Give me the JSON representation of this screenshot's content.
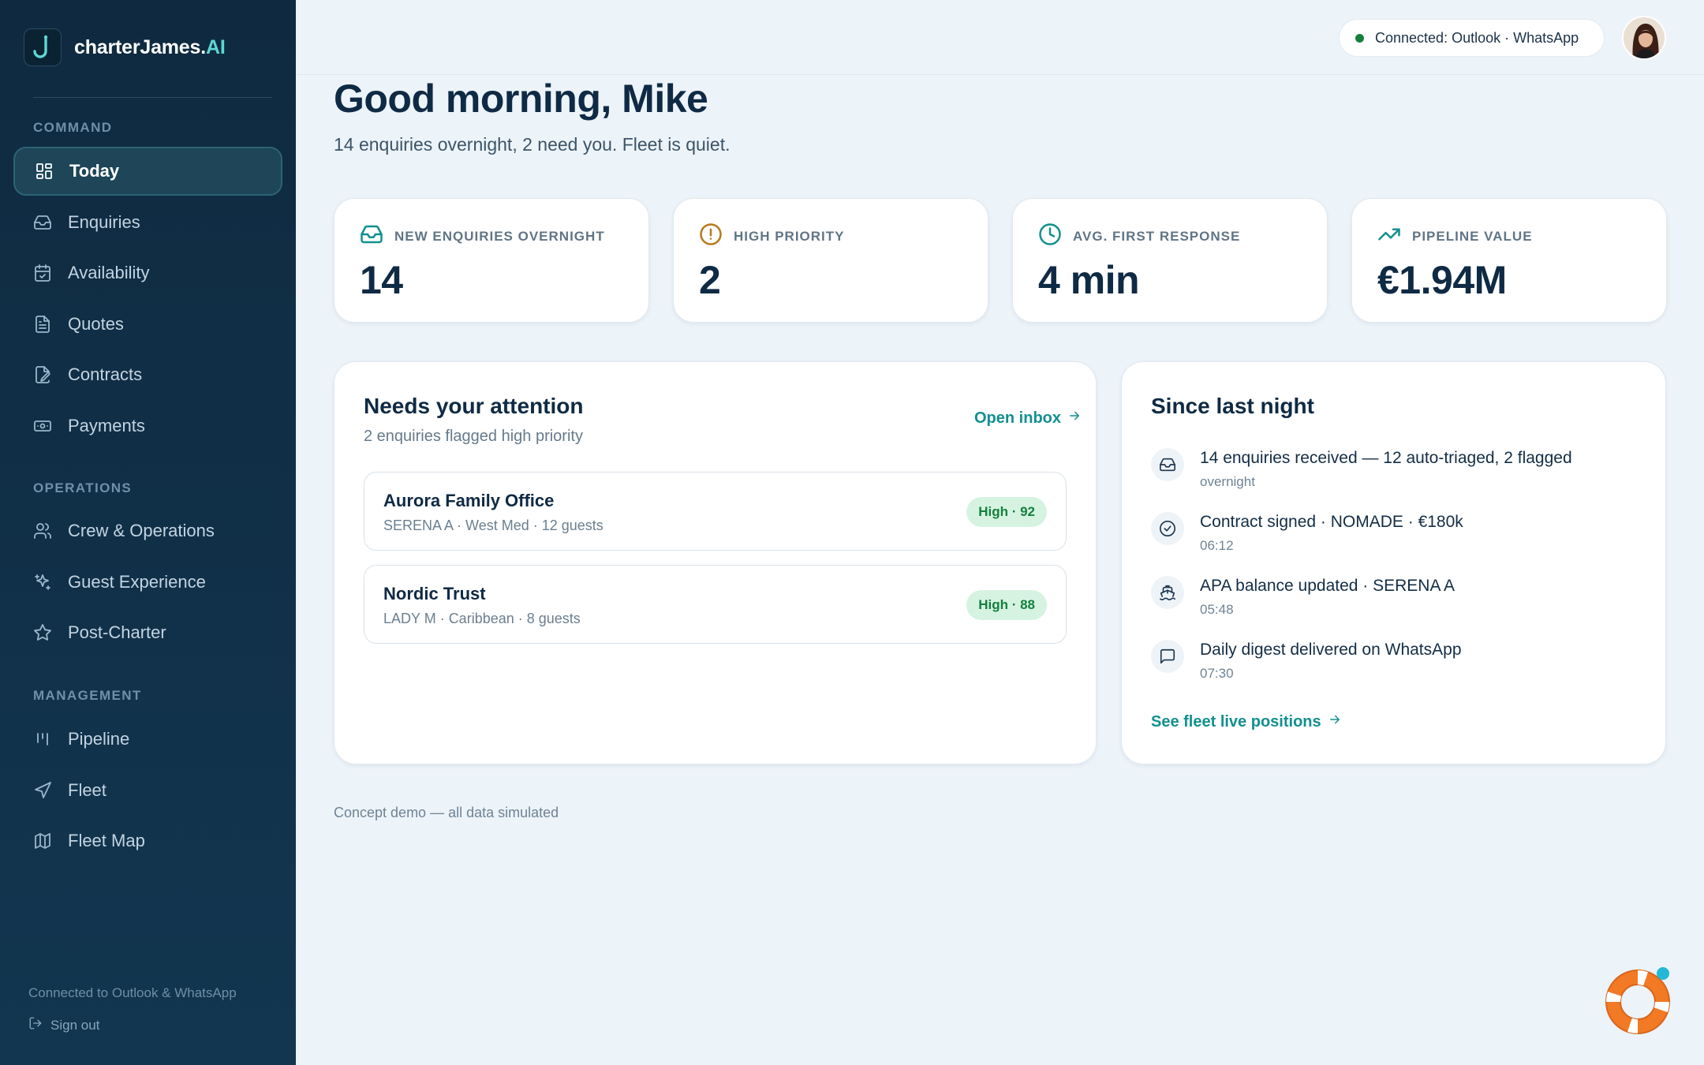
{
  "brand": {
    "name": "charterJames.",
    "suffix": "AI"
  },
  "sidebar": {
    "sections": [
      {
        "label": "COMMAND",
        "items": [
          {
            "label": "Today",
            "icon": "dashboard-icon",
            "active": true
          },
          {
            "label": "Enquiries",
            "icon": "inbox-icon"
          },
          {
            "label": "Availability",
            "icon": "calendar-check-icon"
          },
          {
            "label": "Quotes",
            "icon": "document-icon"
          },
          {
            "label": "Contracts",
            "icon": "file-signature-icon"
          },
          {
            "label": "Payments",
            "icon": "banknote-icon"
          }
        ]
      },
      {
        "label": "OPERATIONS",
        "items": [
          {
            "label": "Crew & Operations",
            "icon": "users-icon"
          },
          {
            "label": "Guest Experience",
            "icon": "sparkles-icon"
          },
          {
            "label": "Post-Charter",
            "icon": "star-icon"
          }
        ]
      },
      {
        "label": "MANAGEMENT",
        "items": [
          {
            "label": "Pipeline",
            "icon": "kanban-icon"
          },
          {
            "label": "Fleet",
            "icon": "navigation-icon"
          },
          {
            "label": "Fleet Map",
            "icon": "map-icon"
          }
        ]
      }
    ],
    "footer_text": "Connected to Outlook & WhatsApp",
    "signout_label": "Sign out"
  },
  "topbar": {
    "connection_status": "Connected: Outlook · WhatsApp",
    "status_color": "#15803d"
  },
  "greeting": {
    "title": "Good morning, Mike",
    "subtitle": "14 enquiries overnight, 2 need you. Fleet is quiet."
  },
  "stats": [
    {
      "label": "NEW ENQUIRIES OVERNIGHT",
      "value": "14",
      "icon": "inbox-icon",
      "color": "#12908f"
    },
    {
      "label": "HIGH PRIORITY",
      "value": "2",
      "icon": "alert-circle-icon",
      "color": "#b7791f"
    },
    {
      "label": "AVG. FIRST RESPONSE",
      "value": "4 min",
      "icon": "clock-icon",
      "color": "#12908f"
    },
    {
      "label": "PIPELINE VALUE",
      "value": "€1.94M",
      "icon": "trending-up-icon",
      "color": "#12908f"
    }
  ],
  "attention": {
    "title": "Needs your attention",
    "subtitle": "2 enquiries flagged high priority",
    "open_inbox_label": "Open inbox",
    "items": [
      {
        "name": "Aurora Family Office",
        "meta": "SERENA A · West Med · 12 guests",
        "badge": "High · 92"
      },
      {
        "name": "Nordic Trust",
        "meta": "LADY M · Caribbean · 8 guests",
        "badge": "High · 88"
      }
    ]
  },
  "activity": {
    "title": "Since last night",
    "items": [
      {
        "text": "14 enquiries received — 12 auto-triaged, 2 flagged",
        "time": "overnight",
        "icon": "inbox-icon"
      },
      {
        "text": "Contract signed · NOMADE · €180k",
        "time": "06:12",
        "icon": "check-circle-icon"
      },
      {
        "text": "APA balance updated · SERENA A",
        "time": "05:48",
        "icon": "ship-icon"
      },
      {
        "text": "Daily digest delivered on WhatsApp",
        "time": "07:30",
        "icon": "message-icon"
      }
    ],
    "link_label": "See fleet live positions"
  },
  "footnote": "Concept demo — all data simulated",
  "colors": {
    "accent": "#12908f",
    "sidebar_bg": "#0f2a40",
    "page_bg": "#ecf3f9",
    "badge_bg": "#d6f3e2",
    "badge_text": "#15803d"
  }
}
